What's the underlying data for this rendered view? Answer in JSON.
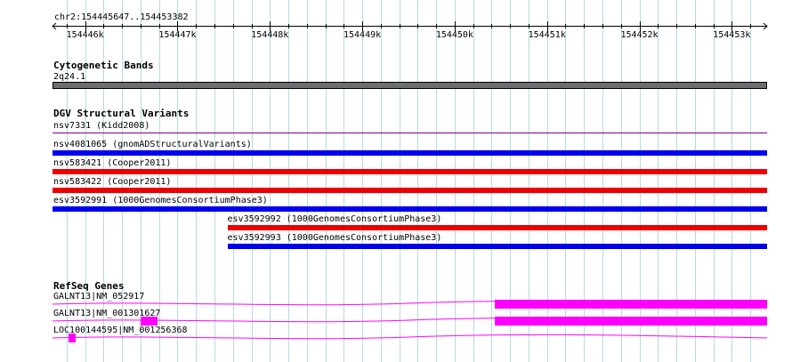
{
  "ruler": {
    "region": "chr2:154445647..154453382",
    "start": 154445647,
    "end": 154453382,
    "ticks": [
      "154446k",
      "154447k",
      "154448k",
      "154449k",
      "154450k",
      "154451k",
      "154452k",
      "154453k"
    ]
  },
  "cytoband": {
    "title": "Cytogenetic Bands",
    "band": "2q24.1"
  },
  "dgv": {
    "title": "DGV Structural Variants",
    "variants": [
      {
        "id": "nsv7331 (Kidd2008)",
        "start": 154445647,
        "end": 154453382,
        "color": "#800080",
        "style": "thin"
      },
      {
        "id": "nsv4081065 (gnomADStructuralVariants)",
        "start": 154445647,
        "end": 154453382,
        "color": "#0000ee",
        "style": "bar"
      },
      {
        "id": "nsv583421 (Cooper2011)",
        "start": 154445647,
        "end": 154453382,
        "color": "#ee0000",
        "style": "bar"
      },
      {
        "id": "nsv583422 (Cooper2011)",
        "start": 154445647,
        "end": 154453382,
        "color": "#ee0000",
        "style": "bar"
      },
      {
        "id": "esv3592991 (1000GenomesConsortiumPhase3)",
        "start": 154445647,
        "end": 154453382,
        "color": "#0000ee",
        "style": "bar"
      },
      {
        "id": "esv3592992 (1000GenomesConsortiumPhase3)",
        "start": 154447540,
        "end": 154453382,
        "color": "#ee0000",
        "style": "bar"
      },
      {
        "id": "esv3592993 (1000GenomesConsortiumPhase3)",
        "start": 154447540,
        "end": 154453382,
        "color": "#0000ee",
        "style": "bar"
      }
    ]
  },
  "refseq": {
    "title": "RefSeq Genes",
    "color": "#ff00ff",
    "genes": [
      {
        "name": "GALNT13|NM_052917",
        "exons": [
          [
            154450430,
            154453382
          ]
        ]
      },
      {
        "name": "GALNT13|NM_001301627",
        "exons": [
          [
            154446600,
            154446780
          ],
          [
            154450430,
            154453382
          ]
        ]
      },
      {
        "name": "LOC100144595|NM_001256368",
        "exons": [
          [
            154445820,
            154445900
          ]
        ]
      }
    ]
  }
}
